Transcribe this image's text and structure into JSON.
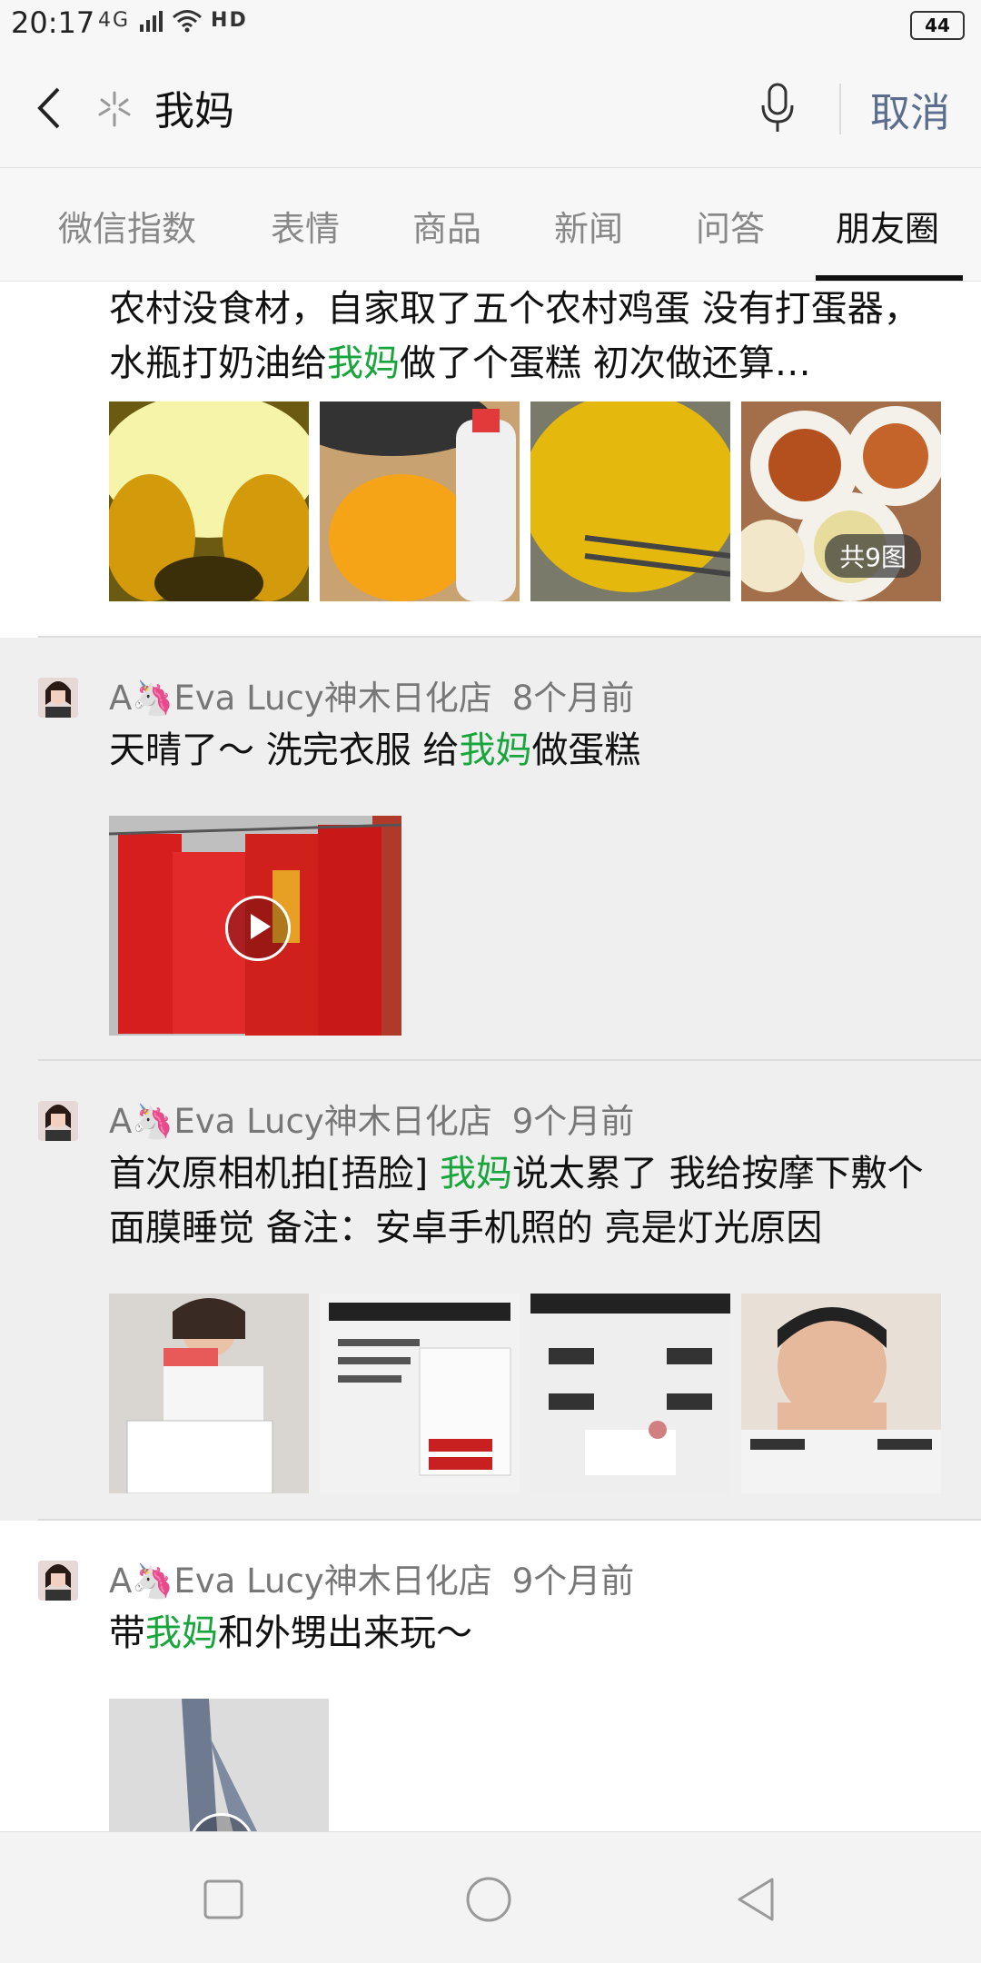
{
  "status": {
    "time": "20:17",
    "network": "4G",
    "hd": "HD",
    "battery": "44"
  },
  "search": {
    "query": "我妈",
    "cancel_label": "取消"
  },
  "tabs": [
    {
      "label": "微信指数"
    },
    {
      "label": "表情"
    },
    {
      "label": "商品"
    },
    {
      "label": "新闻"
    },
    {
      "label": "问答"
    },
    {
      "label": "朋友圈"
    }
  ],
  "active_tab": "朋友圈",
  "highlight_color": "#18a63c",
  "posts": [
    {
      "content_parts": [
        "农村没食材，自家取了五个农村鸡蛋 没有打蛋器，水瓶打奶油给",
        "我妈",
        "做了个蛋糕 初次做还算…"
      ],
      "image_count_label": "共9图"
    },
    {
      "author": "A🦄Eva Lucy神木日化店",
      "time": "8个月前",
      "content_parts": [
        "天晴了～ 洗完衣服 给",
        "我妈",
        "做蛋糕"
      ],
      "media": "video"
    },
    {
      "author": "A🦄Eva Lucy神木日化店",
      "time": "9个月前",
      "content_parts": [
        "首次原相机拍[捂脸] ",
        "我妈",
        "说太累了 我给按摩下敷个面膜睡觉 备注：安卓手机照的 亮是灯光原因"
      ],
      "media": "images"
    },
    {
      "author": "A🦄Eva Lucy神木日化店",
      "time": "9个月前",
      "content_parts": [
        "带",
        "我妈",
        "和外甥出来玩～"
      ],
      "media": "video"
    }
  ]
}
